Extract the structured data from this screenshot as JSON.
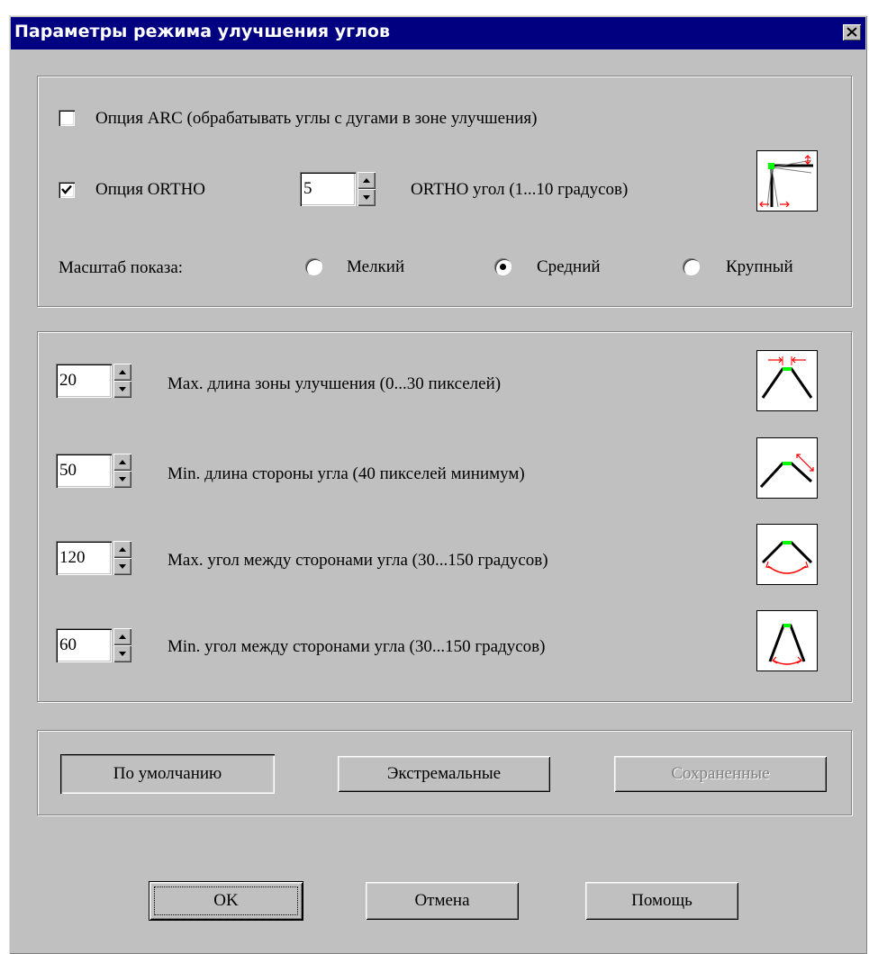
{
  "window": {
    "title": "Параметры режима улучшения углов"
  },
  "top_group": {
    "arc_option": {
      "label": "Опция ARC (обрабатывать углы с дугами в зоне улучшения)",
      "checked": false
    },
    "ortho_option": {
      "label": "Опция ORTHO",
      "checked": true,
      "value": "5",
      "range_label": "ORTHO угол (1...10 градусов)"
    },
    "scale": {
      "label": "Масштаб показа:",
      "options": [
        {
          "label": "Мелкий",
          "selected": false
        },
        {
          "label": "Средний",
          "selected": true
        },
        {
          "label": "Крупный",
          "selected": false
        }
      ]
    }
  },
  "params_group": {
    "rows": [
      {
        "value": "20",
        "label": "Max. длина зоны улучшения (0...30 пикселей)",
        "icon": "max-zone-length-icon"
      },
      {
        "value": "50",
        "label": "Min. длина стороны угла (40 пикселей минимум)",
        "icon": "min-side-length-icon"
      },
      {
        "value": "120",
        "label": "Max. угол между сторонами угла (30...150 градусов)",
        "icon": "max-angle-icon"
      },
      {
        "value": "60",
        "label": "Min. угол между сторонами угла (30...150 градусов)",
        "icon": "min-angle-icon"
      }
    ]
  },
  "presets": {
    "default_label": "По умолчанию",
    "extreme_label": "Экстремальные",
    "saved_label": "Сохраненные"
  },
  "footer": {
    "ok_label": "OK",
    "cancel_label": "Отмена",
    "help_label": "Помощь"
  },
  "colors": {
    "title_bar": "#000080",
    "face": "#c0c0c0",
    "accent_green": "#00ff00",
    "accent_red": "#ff0000"
  }
}
